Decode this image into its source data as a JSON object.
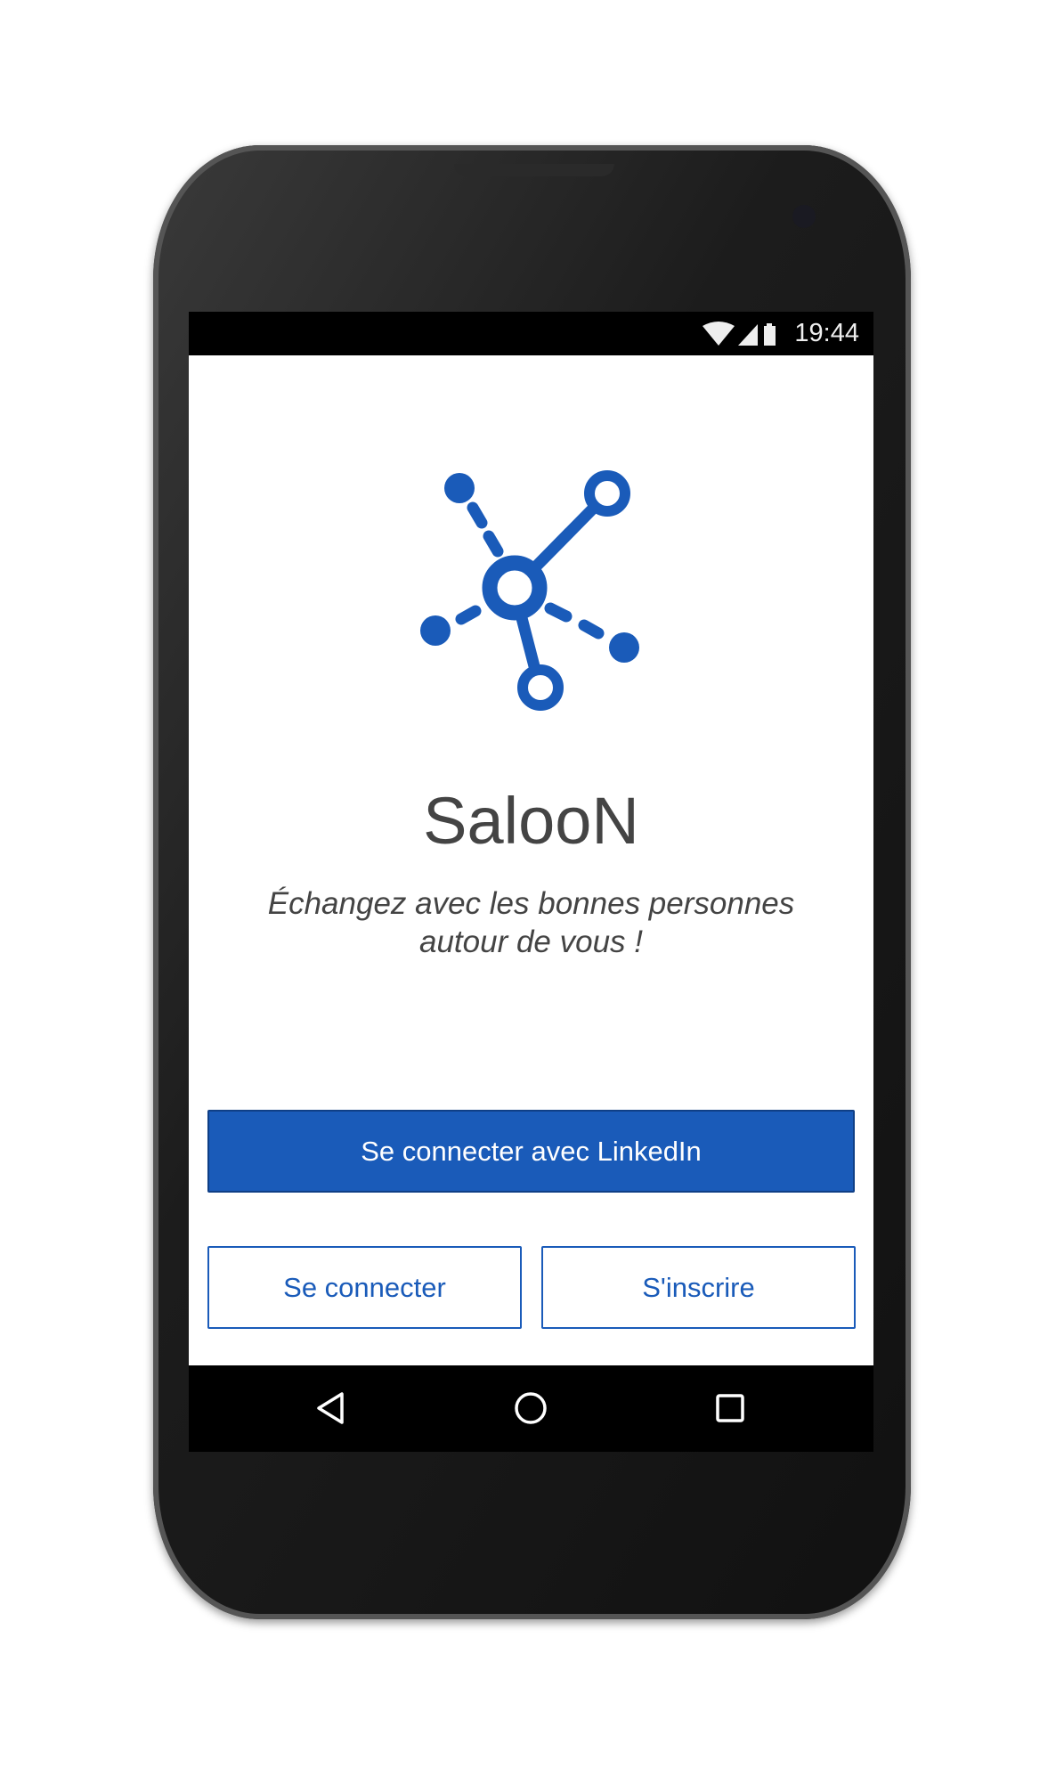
{
  "status_bar": {
    "time": "19:44",
    "icons": [
      "wifi-icon",
      "signal-icon",
      "battery-icon"
    ]
  },
  "app": {
    "title": "SalooN",
    "subtitle_line1": "Échangez avec les bonnes personnes",
    "subtitle_line2": "autour de vous !",
    "brand_color": "#1a5bb9"
  },
  "buttons": {
    "linkedin": "Se connecter avec LinkedIn",
    "login": "Se connecter",
    "signup": "S'inscrire"
  },
  "nav_bar": {
    "icons": [
      "back-icon",
      "home-icon",
      "recents-icon"
    ]
  }
}
